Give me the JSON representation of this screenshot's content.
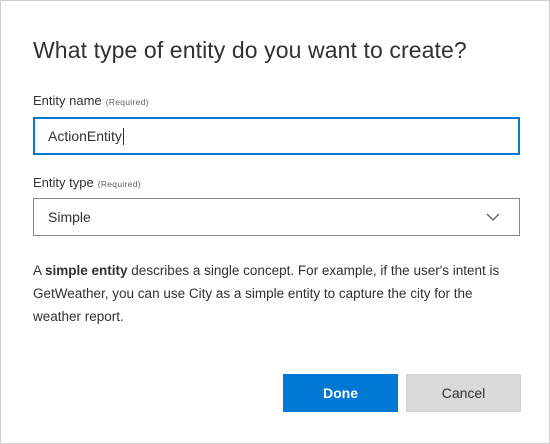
{
  "dialog": {
    "title": "What type of entity do you want to create?",
    "entity_name": {
      "label": "Entity name",
      "required_tag": "(Required)",
      "value": "ActionEntity"
    },
    "entity_type": {
      "label": "Entity type",
      "required_tag": "(Required)",
      "selected": "Simple",
      "icon": "chevron-down-icon"
    },
    "description": {
      "prefix": "A ",
      "emphasis": "simple entity",
      "suffix": " describes a single concept. For example, if the user's intent is GetWeather, you can use City as a simple entity to capture the city for the weather report."
    },
    "buttons": {
      "done": "Done",
      "cancel": "Cancel"
    },
    "colors": {
      "primary": "#0078d4",
      "secondary_bg": "#d9d9d9",
      "text": "#323130"
    }
  }
}
